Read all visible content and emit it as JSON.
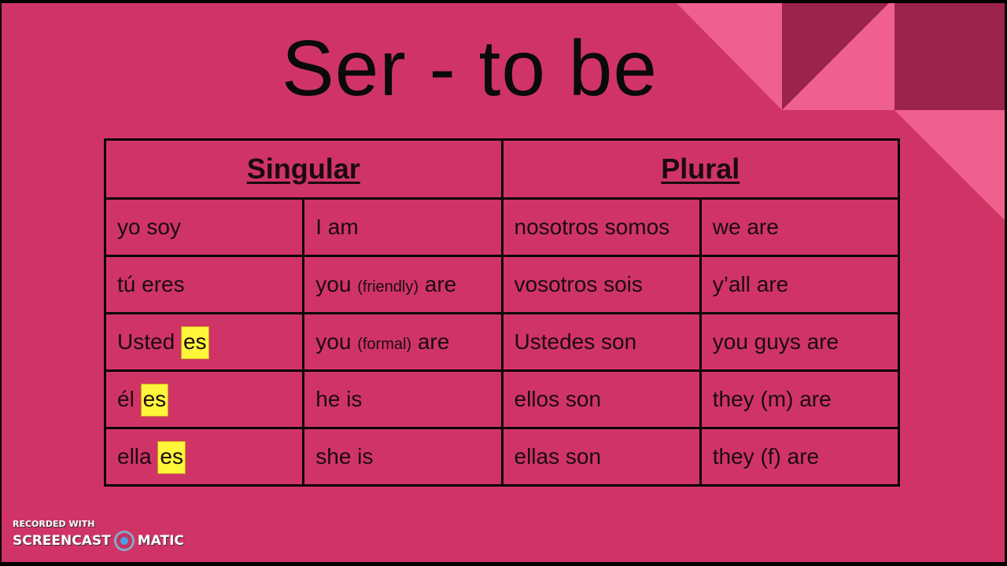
{
  "slide": {
    "title": "Ser - to be",
    "colors": {
      "background": "#d03467",
      "accent_light": "#f0608e",
      "accent_dark": "#9c234b",
      "highlight": "#fdf63b"
    }
  },
  "table": {
    "headers": [
      "Singular",
      "Plural"
    ],
    "rows": [
      {
        "singular_es": {
          "pronoun": "yo soy",
          "verb": ""
        },
        "singular_en": {
          "before": "I am",
          "note": "",
          "after": ""
        },
        "plural_es": "nosotros somos",
        "plural_en": "we are"
      },
      {
        "singular_es": {
          "pronoun": "tú eres",
          "verb": ""
        },
        "singular_en": {
          "before": "you",
          "note": "(friendly)",
          "after": "are"
        },
        "plural_es": "vosotros sois",
        "plural_en": "y’all are"
      },
      {
        "singular_es": {
          "pronoun": "Usted",
          "verb": "es"
        },
        "singular_en": {
          "before": "you",
          "note": "(formal)",
          "after": "are"
        },
        "plural_es": "Ustedes son",
        "plural_en": "you guys are"
      },
      {
        "singular_es": {
          "pronoun": "él",
          "verb": "es"
        },
        "singular_en": {
          "before": "he is",
          "note": "",
          "after": ""
        },
        "plural_es": "ellos son",
        "plural_en": "they (m) are"
      },
      {
        "singular_es": {
          "pronoun": "ella",
          "verb": "es"
        },
        "singular_en": {
          "before": "she is",
          "note": "",
          "after": ""
        },
        "plural_es": "ellas son",
        "plural_en": "they (f) are"
      }
    ]
  },
  "watermark": {
    "line1": "RECORDED WITH",
    "brand_left": "SCREENCAST",
    "brand_right": "MATIC",
    "icon": "record-icon"
  }
}
